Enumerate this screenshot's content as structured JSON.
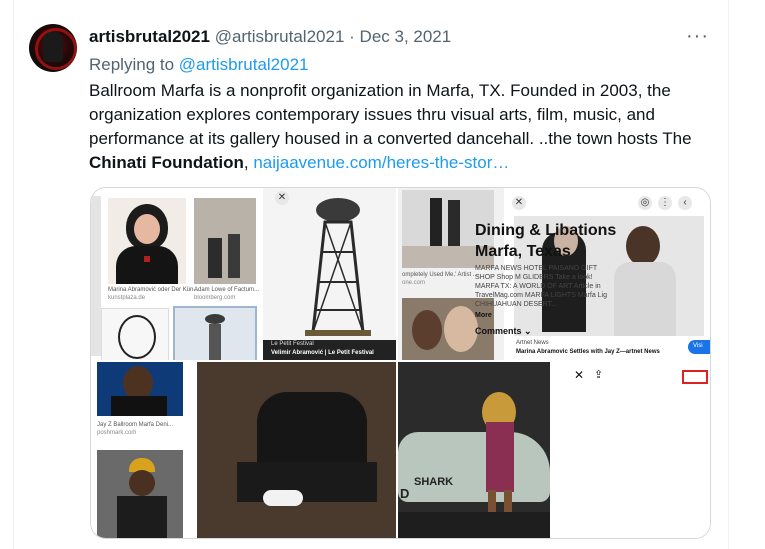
{
  "tweet": {
    "display_name": "artisbrutal2021",
    "handle": "@artisbrutal2021",
    "separator": "·",
    "date": "Dec 3, 2021",
    "more_label": "···",
    "replying_prefix": "Replying to ",
    "replying_handle": "@artisbrutal2021",
    "text_part1": "Ballroom Marfa is a nonprofit organization in Marfa, TX. Founded in 2003, the organization explores contemporary issues thru visual arts, film, music, and performance at its gallery housed in a converted dancehall. ..the town hosts The ",
    "text_bold": "Chinati Foundation",
    "text_part2": ", ",
    "link_text": "naijaavenue.com/heres-the-stor…"
  },
  "media": {
    "image1": {
      "captions": [
        "Marina Abramović oder Der Kün...",
        "kunstplaza.de",
        "Adam Lowe of Factum...",
        "bloomberg.com"
      ],
      "badge": "Le Petit Festival",
      "title": "Velimir Abramović | Le Petit Festival"
    },
    "image2": {
      "caption1": "ompletely Used Me,' Artist ...",
      "caption2": "one.com",
      "source": "Artnet News",
      "title": "Marina Abramovic Settles with Jay Z—artnet News",
      "visit": "Visi"
    },
    "image3": {
      "caption1": "Jay Z Ballroom Marfa Deni...",
      "caption2": "poshmark.com"
    },
    "image4": {
      "car_text": "SHARK",
      "car_text2": "D",
      "heading_line1": "Dining & Libations",
      "heading_line2": "Marfa, Texas",
      "body": "MARFA NEWS HOTEL PAISANO GIFT SHOP Shop M GLIDERS Take a look! MARFA TX: A WORLD OF ART Article in TravelMag.com MARFA LIGHTS Marfa Lig CHIHUAHUAN DESERT...",
      "more": "More",
      "comments": "Comments"
    }
  },
  "colors": {
    "link": "#1d9bf0",
    "secondary": "#536471",
    "primary": "#0f1419"
  }
}
